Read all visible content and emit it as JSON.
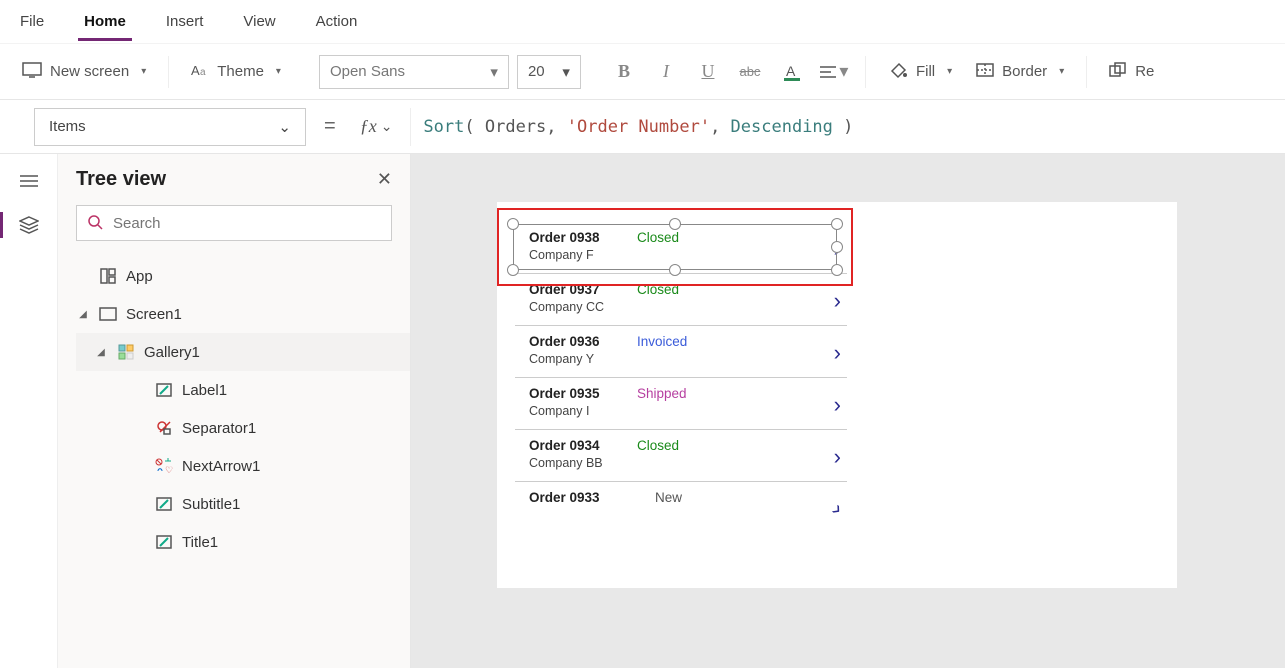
{
  "menu": {
    "file": "File",
    "home": "Home",
    "insert": "Insert",
    "view": "View",
    "action": "Action"
  },
  "toolbar": {
    "new_screen": "New screen",
    "theme": "Theme",
    "font_name": "Open Sans",
    "font_size": "20",
    "fill": "Fill",
    "border": "Border",
    "reorder": "Re"
  },
  "formula": {
    "property": "Items",
    "fn": "Sort",
    "arg1": " Orders",
    "arg2": "'Order Number'",
    "arg3": "Descending"
  },
  "panel": {
    "title": "Tree view",
    "search_placeholder": "Search",
    "nodes": {
      "app": "App",
      "screen1": "Screen1",
      "gallery1": "Gallery1",
      "label1": "Label1",
      "sep1": "Separator1",
      "next1": "NextArrow1",
      "sub1": "Subtitle1",
      "title1": "Title1"
    }
  },
  "gallery": {
    "items": [
      {
        "title": "Order 0938",
        "sub": "Company F",
        "status": "Closed",
        "cls": "st-closed"
      },
      {
        "title": "Order 0937",
        "sub": "Company CC",
        "status": "Closed",
        "cls": "st-closed"
      },
      {
        "title": "Order 0936",
        "sub": "Company Y",
        "status": "Invoiced",
        "cls": "st-invoiced"
      },
      {
        "title": "Order 0935",
        "sub": "Company I",
        "status": "Shipped",
        "cls": "st-shipped"
      },
      {
        "title": "Order 0934",
        "sub": "Company BB",
        "status": "Closed",
        "cls": "st-closed"
      },
      {
        "title": "Order 0933",
        "sub": "",
        "status": "New",
        "cls": "st-new"
      }
    ]
  }
}
